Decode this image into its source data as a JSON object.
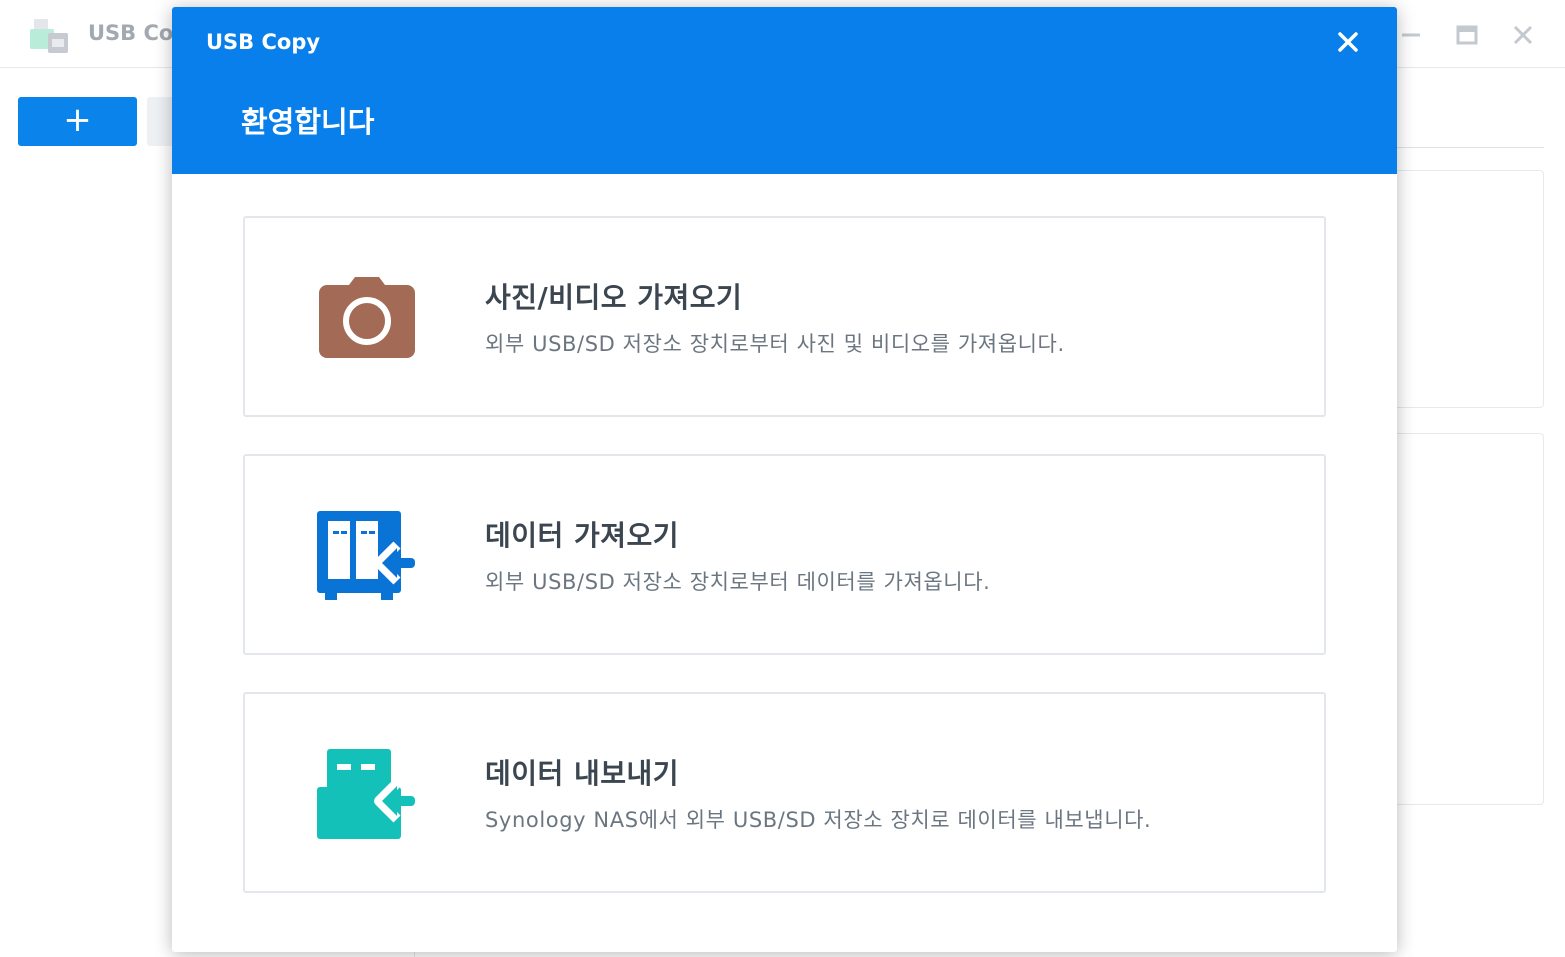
{
  "app": {
    "title": "USB Co",
    "add_button_label": "+"
  },
  "dialog": {
    "title": "USB Copy",
    "welcome": "환영합니다",
    "options": [
      {
        "icon": "camera-icon",
        "title": "사진/비디오 가져오기",
        "description": "외부 USB/SD 저장소 장치로부터 사진 및 비디오를 가져옵니다."
      },
      {
        "icon": "nas-import-icon",
        "title": "데이터 가져오기",
        "description": "외부 USB/SD 저장소 장치로부터 데이터를 가져옵니다."
      },
      {
        "icon": "usb-export-icon",
        "title": "데이터 내보내기",
        "description": "Synology NAS에서 외부 USB/SD 저장소 장치로 데이터를 내보냅니다."
      }
    ]
  },
  "colors": {
    "header_blue": "#087fea",
    "camera_brown": "#a36a55",
    "nas_blue": "#0a74d6",
    "usb_teal": "#14c1b9"
  }
}
